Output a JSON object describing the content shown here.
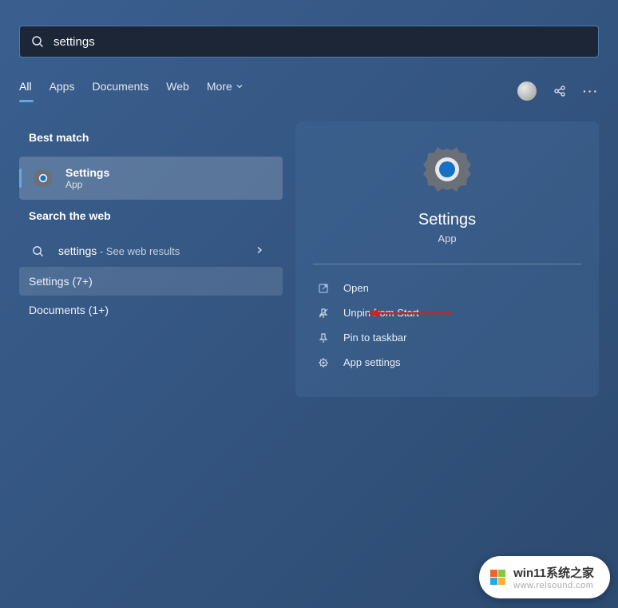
{
  "search": {
    "value": "settings"
  },
  "tabs": {
    "all": "All",
    "apps": "Apps",
    "documents": "Documents",
    "web": "Web",
    "more": "More"
  },
  "left": {
    "best_match_header": "Best match",
    "result": {
      "title": "Settings",
      "subtitle": "App"
    },
    "search_web_header": "Search the web",
    "web_result": {
      "term": "settings",
      "suffix": " - See web results"
    },
    "settings_row": "Settings (7+)",
    "documents_row": "Documents (1+)"
  },
  "preview": {
    "title": "Settings",
    "subtitle": "App",
    "actions": {
      "open": "Open",
      "unpin": "Unpin from Start",
      "pin_taskbar": "Pin to taskbar",
      "app_settings": "App settings"
    }
  },
  "watermark": {
    "title": "win11系统之家",
    "url": "www.relsound.com"
  },
  "colors": {
    "accent": "#67a7e0",
    "arrow": "#d62020"
  }
}
